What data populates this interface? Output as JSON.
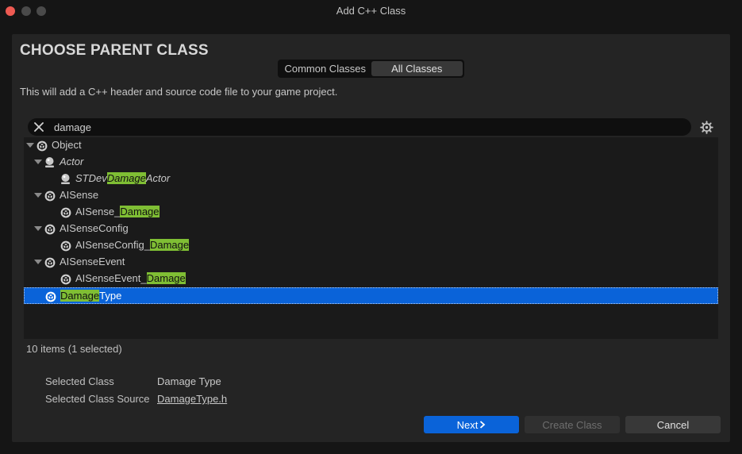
{
  "window": {
    "title": "Add C++ Class"
  },
  "dialog": {
    "heading": "CHOOSE PARENT CLASS",
    "tabs": [
      {
        "label": "Common Classes",
        "active": false
      },
      {
        "label": "All Classes",
        "active": true
      }
    ],
    "description": "This will add a C++ header and source code file to your game project."
  },
  "search": {
    "value": "damage"
  },
  "tree": {
    "rows": [
      {
        "pre": "Object",
        "match": "",
        "post": "",
        "expanded": true,
        "depth": 0,
        "icon": "uobject-icon",
        "italic": false,
        "selected": false
      },
      {
        "pre": "Actor",
        "match": "",
        "post": "",
        "expanded": true,
        "depth": 1,
        "icon": "actor-icon",
        "italic": true,
        "selected": false
      },
      {
        "pre": "STDev",
        "match": "Damage",
        "post": "Actor",
        "expanded": false,
        "depth": 2,
        "icon": "actor-icon",
        "italic": true,
        "selected": false
      },
      {
        "pre": "AISense",
        "match": "",
        "post": "",
        "expanded": true,
        "depth": 1,
        "icon": "uobject-icon",
        "italic": false,
        "selected": false
      },
      {
        "pre": "AISense_",
        "match": "Damage",
        "post": "",
        "expanded": false,
        "depth": 2,
        "icon": "uobject-icon",
        "italic": false,
        "selected": false
      },
      {
        "pre": "AISenseConfig",
        "match": "",
        "post": "",
        "expanded": true,
        "depth": 1,
        "icon": "uobject-icon",
        "italic": false,
        "selected": false
      },
      {
        "pre": "AISenseConfig_",
        "match": "Damage",
        "post": "",
        "expanded": false,
        "depth": 2,
        "icon": "uobject-icon",
        "italic": false,
        "selected": false
      },
      {
        "pre": "AISenseEvent",
        "match": "",
        "post": "",
        "expanded": true,
        "depth": 1,
        "icon": "uobject-icon",
        "italic": false,
        "selected": false
      },
      {
        "pre": "AISenseEvent_",
        "match": "Damage",
        "post": "",
        "expanded": false,
        "depth": 2,
        "icon": "uobject-icon",
        "italic": false,
        "selected": false
      },
      {
        "pre": "",
        "match": "Damage",
        "post": "Type",
        "expanded": false,
        "depth": 1,
        "icon": "uobject-icon",
        "italic": false,
        "selected": true
      }
    ]
  },
  "status": {
    "count": "10 items (1 selected)"
  },
  "details": {
    "selected_class_label": "Selected Class",
    "selected_class_value": "Damage Type",
    "selected_source_label": "Selected Class Source",
    "selected_source_value": "DamageType.h"
  },
  "buttons": {
    "next": "Next",
    "create": "Create Class",
    "cancel": "Cancel"
  },
  "colors": {
    "accent": "#0a63d9",
    "highlight": "#7fbe34",
    "close": "#ee5a52"
  }
}
